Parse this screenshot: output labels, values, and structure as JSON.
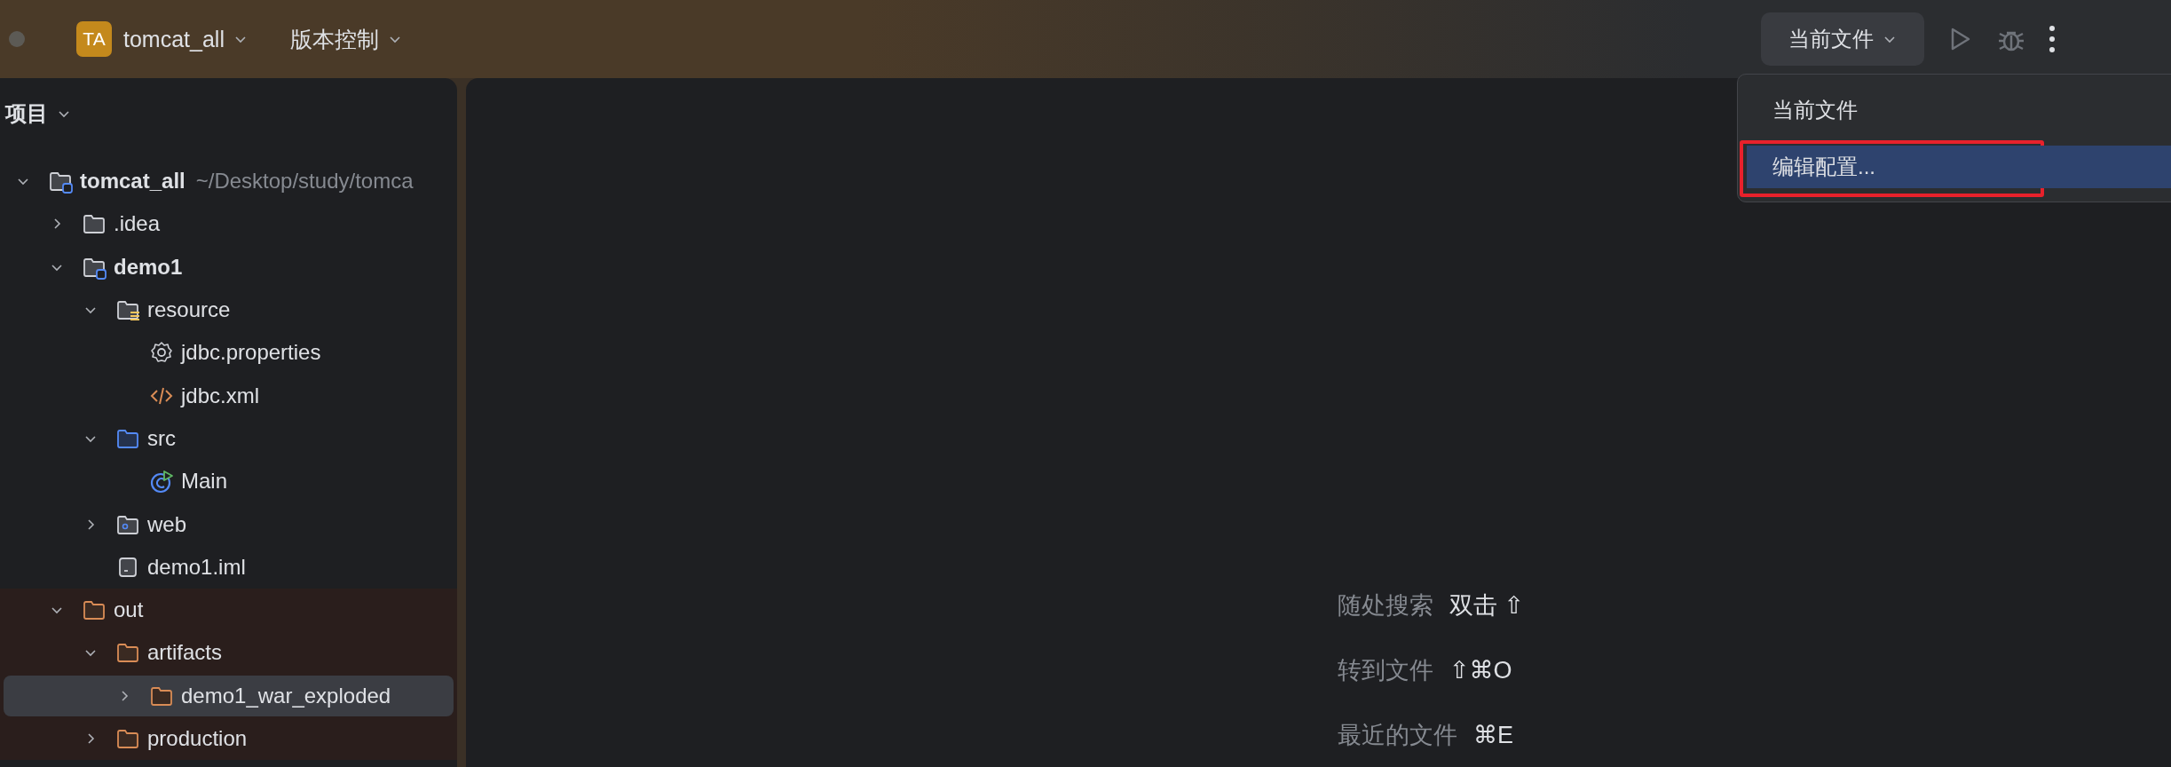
{
  "title_bar": {
    "project_badge": "TA",
    "project_name": "tomcat_all",
    "vcs_menu": "版本控制",
    "run_config": "当前文件"
  },
  "run_menu": {
    "items": [
      {
        "label": "当前文件",
        "selected": false,
        "annotated": false
      },
      {
        "label": "编辑配置...",
        "selected": true,
        "annotated": true
      }
    ]
  },
  "sidebar": {
    "title": "项目",
    "tree": [
      {
        "name": "tomcat_all",
        "path": "~/Desktop/study/tomca",
        "kind": "module",
        "expanded": true,
        "selected": false,
        "excluded": false,
        "children": [
          {
            "name": ".idea",
            "kind": "folder",
            "expanded": false,
            "selected": false,
            "excluded": false
          },
          {
            "name": "demo1",
            "kind": "module",
            "expanded": true,
            "selected": false,
            "excluded": false,
            "children": [
              {
                "name": "resource",
                "kind": "resources",
                "expanded": true,
                "selected": false,
                "excluded": false,
                "children": [
                  {
                    "name": "jdbc.properties",
                    "kind": "properties",
                    "selected": false,
                    "excluded": false
                  },
                  {
                    "name": "jdbc.xml",
                    "kind": "xml",
                    "selected": false,
                    "excluded": false
                  }
                ]
              },
              {
                "name": "src",
                "kind": "source",
                "expanded": true,
                "selected": false,
                "excluded": false,
                "children": [
                  {
                    "name": "Main",
                    "kind": "class",
                    "selected": false,
                    "excluded": false
                  }
                ]
              },
              {
                "name": "web",
                "kind": "web",
                "expanded": false,
                "selected": false,
                "excluded": false
              },
              {
                "name": "demo1.iml",
                "kind": "file",
                "selected": false,
                "excluded": false
              }
            ]
          },
          {
            "name": "out",
            "kind": "folder",
            "expanded": true,
            "selected": false,
            "excluded": true,
            "children": [
              {
                "name": "artifacts",
                "kind": "folder",
                "expanded": true,
                "selected": false,
                "excluded": true,
                "children": [
                  {
                    "name": "demo1_war_exploded",
                    "kind": "folder",
                    "expanded": false,
                    "selected": true,
                    "excluded": true
                  }
                ]
              },
              {
                "name": "production",
                "kind": "folder",
                "expanded": false,
                "selected": false,
                "excluded": true
              }
            ]
          }
        ]
      }
    ]
  },
  "editor_hints": [
    {
      "label": "随处搜索",
      "shortcut": "双击 ⇧"
    },
    {
      "label": "转到文件",
      "shortcut": "⇧⌘O"
    },
    {
      "label": "最近的文件",
      "shortcut": "⌘E"
    }
  ]
}
